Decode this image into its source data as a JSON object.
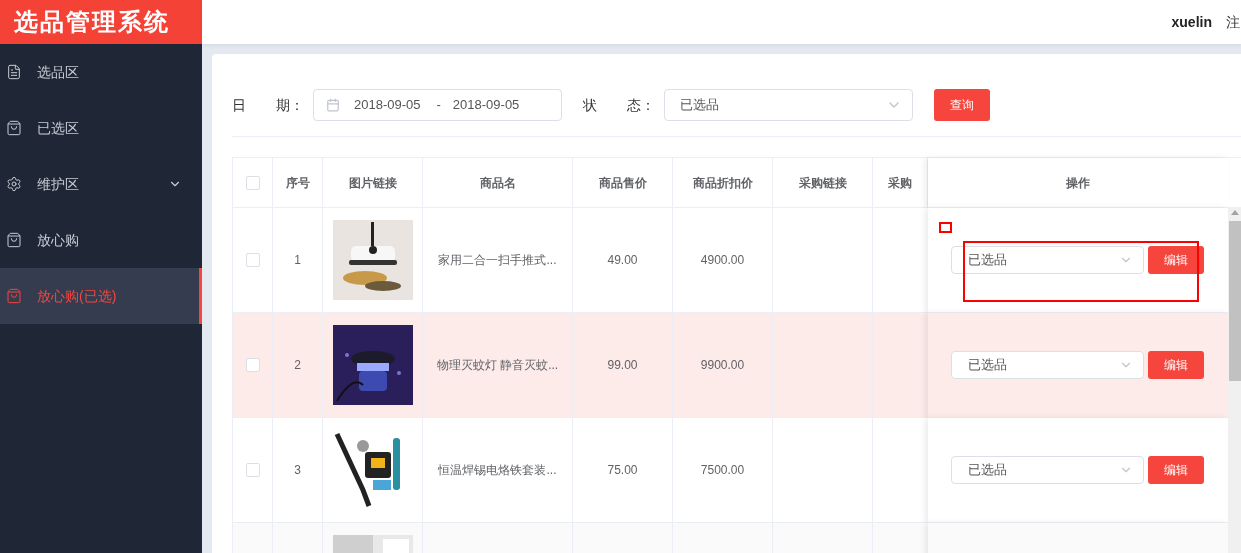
{
  "app_title": "选品管理系统",
  "header": {
    "user": "xuelin",
    "logout": "注"
  },
  "sidebar": {
    "items": [
      {
        "label": "选品区",
        "selected": false
      },
      {
        "label": "已选区",
        "selected": false
      },
      {
        "label": "维护区",
        "selected": false,
        "expanded": false
      },
      {
        "label": "放心购",
        "selected": false
      },
      {
        "label": "放心购(已选)",
        "selected": true
      }
    ]
  },
  "filters": {
    "date_label": "日 期：",
    "date_start": "2018-09-05",
    "date_sep": "-",
    "date_end": "2018-09-05",
    "status_label": "状 态：",
    "status_value": "已选品",
    "query_button": "查询"
  },
  "table": {
    "columns": [
      "序号",
      "图片链接",
      "商品名",
      "商品售价",
      "商品折扣价",
      "采购链接",
      "采购",
      "操作"
    ],
    "header_checked": false,
    "rows": [
      {
        "checked": false,
        "selected": false,
        "index": "1",
        "name": "家用二合一扫手推式...",
        "price": "49.00",
        "discount": "4900.00",
        "status": "已选品",
        "edit": "编辑"
      },
      {
        "checked": false,
        "selected": true,
        "index": "2",
        "name": "物理灭蚊灯 静音灭蚊...",
        "price": "99.00",
        "discount": "9900.00",
        "status": "已选品",
        "edit": "编辑"
      },
      {
        "checked": false,
        "selected": false,
        "index": "3",
        "name": "恒温焊锡电烙铁套装...",
        "price": "75.00",
        "discount": "7500.00",
        "status": "已选品",
        "edit": "编辑"
      },
      {
        "selected": false
      }
    ]
  }
}
